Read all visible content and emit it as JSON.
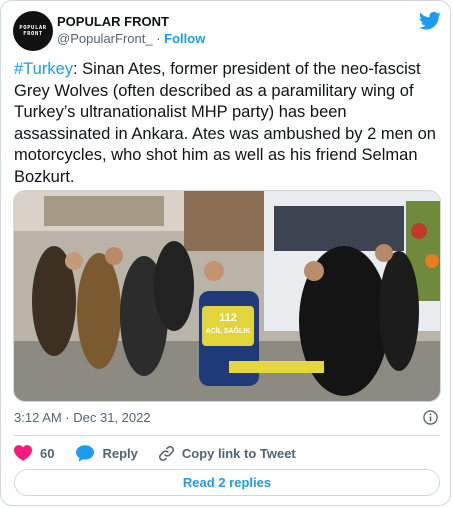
{
  "author": {
    "logo_lines": [
      "POPULAR",
      "FRONT"
    ],
    "name": "POPULAR FRONT",
    "handle": "@PopularFront_",
    "separator": "·",
    "follow_label": "Follow"
  },
  "tweet": {
    "hashtag": "#Turkey",
    "body": ": Sinan Ates, former president of the neo-fascist Grey Wolves (often described as a paramilitary wing of Turkey’s ultranationalist MHP party) has been assassinated in Ankara. Ates was ambushed by 2 men on motorcycles, who shot him as well as his friend Selman Bozkurt.",
    "photo_vest_number": "112",
    "photo_vest_text": "ACİL SAĞLIK",
    "timestamp": "3:12 AM · Dec 31, 2022"
  },
  "actions": {
    "like_count": "60",
    "reply_label": "Reply",
    "copy_label": "Copy link to Tweet"
  },
  "read_replies_label": "Read 2 replies",
  "icons": {
    "brand": "twitter-bird-icon",
    "like": "heart-icon",
    "reply": "speech-bubble-icon",
    "copy": "link-icon",
    "info": "info-icon"
  },
  "colors": {
    "accent": "#1d9bf0",
    "like": "#f91880",
    "text": "#0f1419",
    "secondary": "#536471",
    "border": "#cfd9de"
  }
}
